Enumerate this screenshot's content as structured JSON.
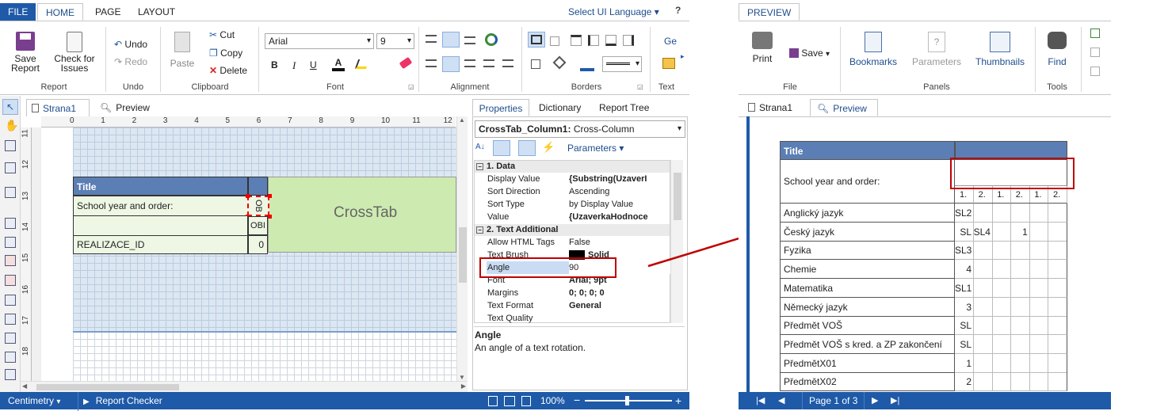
{
  "ribbon": {
    "tabs": [
      "FILE",
      "HOME",
      "PAGE",
      "LAYOUT"
    ],
    "ui_language": "Select UI Language",
    "help": "?",
    "buttons": {
      "save_report": [
        "Save",
        "Report"
      ],
      "check_issues": [
        "Check for",
        "Issues"
      ],
      "undo": "Undo",
      "redo": "Redo",
      "paste": "Paste",
      "cut": "Cut",
      "copy": "Copy",
      "delete": "Delete",
      "font_name": "Arial",
      "font_size": "9",
      "bold": "B",
      "italic": "I",
      "underline": "U",
      "general": "Ge"
    },
    "groups": [
      "Report",
      "Undo",
      "Clipboard",
      "Font",
      "Alignment",
      "Borders",
      "Text"
    ]
  },
  "doc_tabs": [
    "Strana1",
    "Preview"
  ],
  "ruler": [
    "0",
    "1",
    "2",
    "3",
    "4",
    "5",
    "6",
    "7",
    "8",
    "9",
    "10",
    "11",
    "12"
  ],
  "vruler": [
    "11",
    "12",
    "13",
    "14",
    "15",
    "16",
    "17",
    "18"
  ],
  "report": {
    "title": "Title",
    "school_label": "School year and order:",
    "col_cell1": "OB",
    "col_cell2": "OBI",
    "crosstab": "CrossTab",
    "realizace": "REALIZACE_ID",
    "zero": "0"
  },
  "properties": {
    "tabs": [
      "Properties",
      "Dictionary",
      "Report Tree"
    ],
    "selected_name": "CrossTab_Column1:",
    "selected_type": "Cross-Column",
    "parameters": "Parameters",
    "cat1": "1. Data",
    "cat2": "2. Text Additional",
    "rows1": [
      {
        "k": "Display Value",
        "v": "{Substring(UzaverI"
      },
      {
        "k": "Sort Direction",
        "v": "Ascending"
      },
      {
        "k": "Sort Type",
        "v": "by Display Value"
      },
      {
        "k": "Value",
        "v": "{UzaverkaHodnoce"
      }
    ],
    "rows2": [
      {
        "k": "Allow HTML Tags",
        "v": "False"
      },
      {
        "k": "Text Brush",
        "v": "Solid"
      },
      {
        "k": "Angle",
        "v": "90"
      },
      {
        "k": "Font",
        "v": "Arial; 9pt"
      },
      {
        "k": "Margins",
        "v": "0; 0; 0; 0"
      },
      {
        "k": "Text Format",
        "v": "General"
      },
      {
        "k": "Text Quality",
        "v": ""
      }
    ],
    "desc_title": "Angle",
    "desc_text": "An angle of a text rotation."
  },
  "statusbar": {
    "units": "Centimetry",
    "checker": "Report Checker",
    "zoom": "100%"
  },
  "preview": {
    "tab": "PREVIEW",
    "print": "Print",
    "save": "Save",
    "bookmarks": "Bookmarks",
    "parameters": "Parameters",
    "thumbnails": "Thumbnails",
    "find": "Find",
    "groups": [
      "File",
      "Panels",
      "Tools"
    ],
    "doc_tabs": [
      "Strana1",
      "Preview"
    ],
    "table_title": "Title",
    "school_label": "School year and order:",
    "headers": [
      "1.",
      "2.",
      "1.",
      "2.",
      "1.",
      "2."
    ],
    "rows": [
      {
        "name": "Anglický jazyk",
        "vals": [
          "SL2",
          "",
          "",
          "",
          "",
          ""
        ]
      },
      {
        "name": "Český jazyk",
        "vals": [
          "SL",
          "SL4",
          "",
          "1",
          "",
          ""
        ]
      },
      {
        "name": "Fyzika",
        "vals": [
          "SL3",
          "",
          "",
          "",
          "",
          ""
        ]
      },
      {
        "name": "Chemie",
        "vals": [
          "4",
          "",
          "",
          "",
          "",
          ""
        ]
      },
      {
        "name": "Matematika",
        "vals": [
          "SL1",
          "",
          "",
          "",
          "",
          ""
        ]
      },
      {
        "name": "Německý jazyk",
        "vals": [
          "3",
          "",
          "",
          "",
          "",
          ""
        ]
      },
      {
        "name": "Předmět VOŠ",
        "vals": [
          "SL",
          "",
          "",
          "",
          "",
          ""
        ]
      },
      {
        "name": "Předmět VOŠ s kred. a ZP zakončení",
        "vals": [
          "SL",
          "",
          "",
          "",
          "",
          ""
        ]
      },
      {
        "name": "PředmětX01",
        "vals": [
          "1",
          "",
          "",
          "",
          "",
          ""
        ]
      },
      {
        "name": "PředmětX02",
        "vals": [
          "2",
          "",
          "",
          "",
          "",
          ""
        ]
      }
    ],
    "page": "Page 1 of 3"
  },
  "colors": {
    "accent": "#1e5aa8",
    "header": "#5b7fb4",
    "red": "#c00000",
    "green": "#cdeab0"
  }
}
